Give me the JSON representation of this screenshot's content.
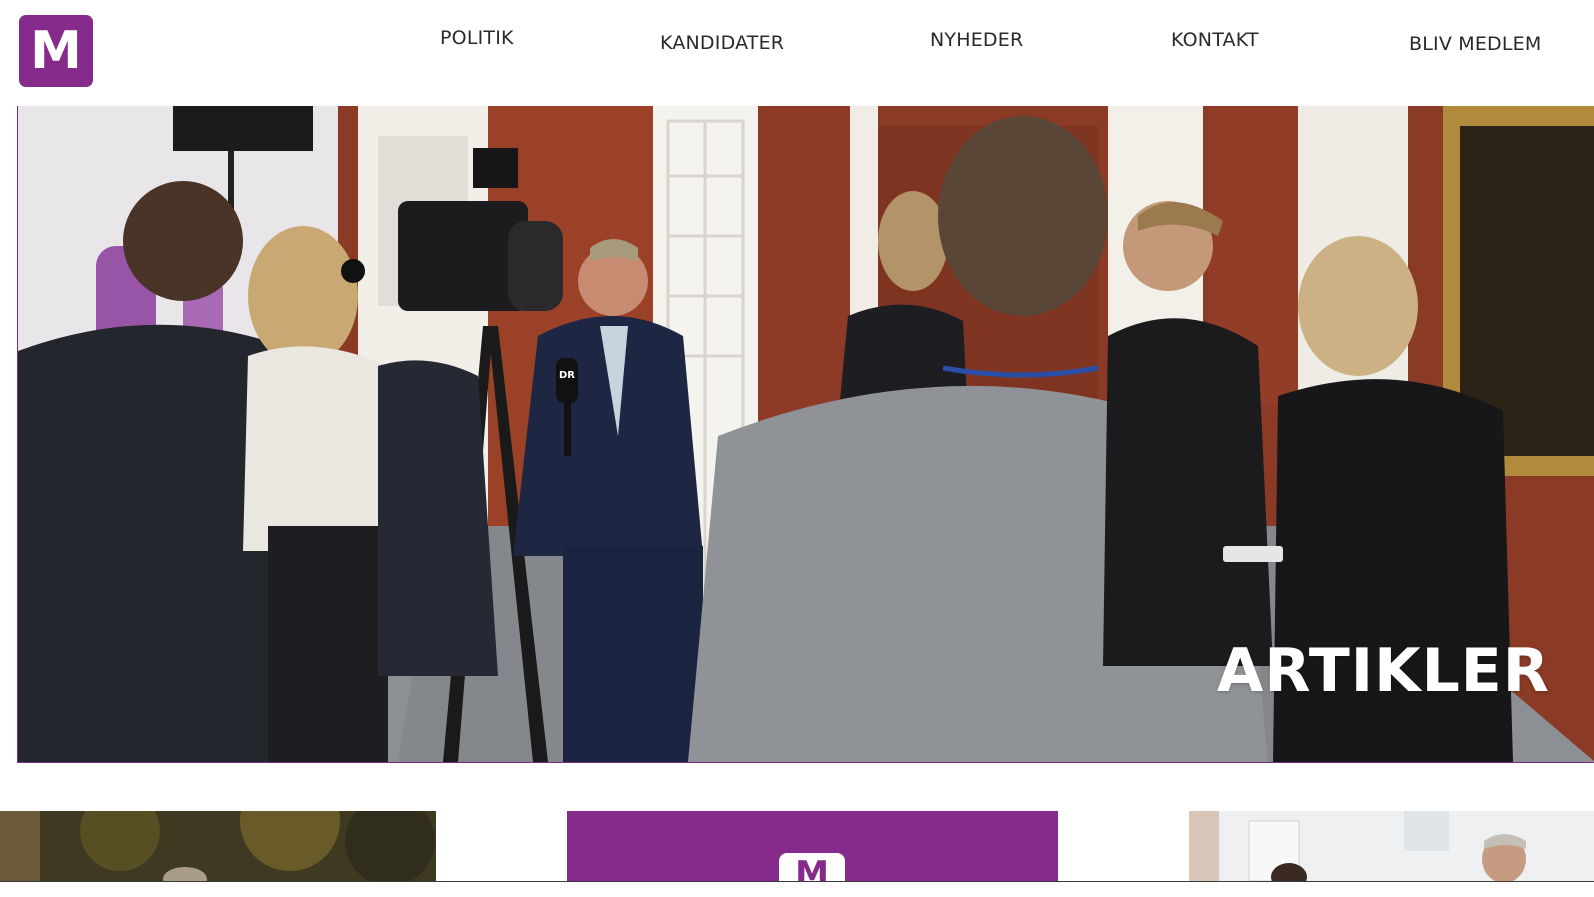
{
  "header": {
    "logo_letter": "M",
    "nav": {
      "politik": "POLITIK",
      "kandidater": "KANDIDATER",
      "nyheder": "NYHEDER",
      "kontakt": "KONTAKT",
      "bliv_medlem": "BLIV MEDLEM"
    }
  },
  "hero": {
    "title": "ARTIKLER",
    "microphone_label": "DR"
  },
  "cards": {
    "card2_logo_letter": "M"
  },
  "colors": {
    "brand_purple": "#862a8c",
    "nav_text": "#2a2a2a",
    "hero_wall": "#8e3b24"
  }
}
